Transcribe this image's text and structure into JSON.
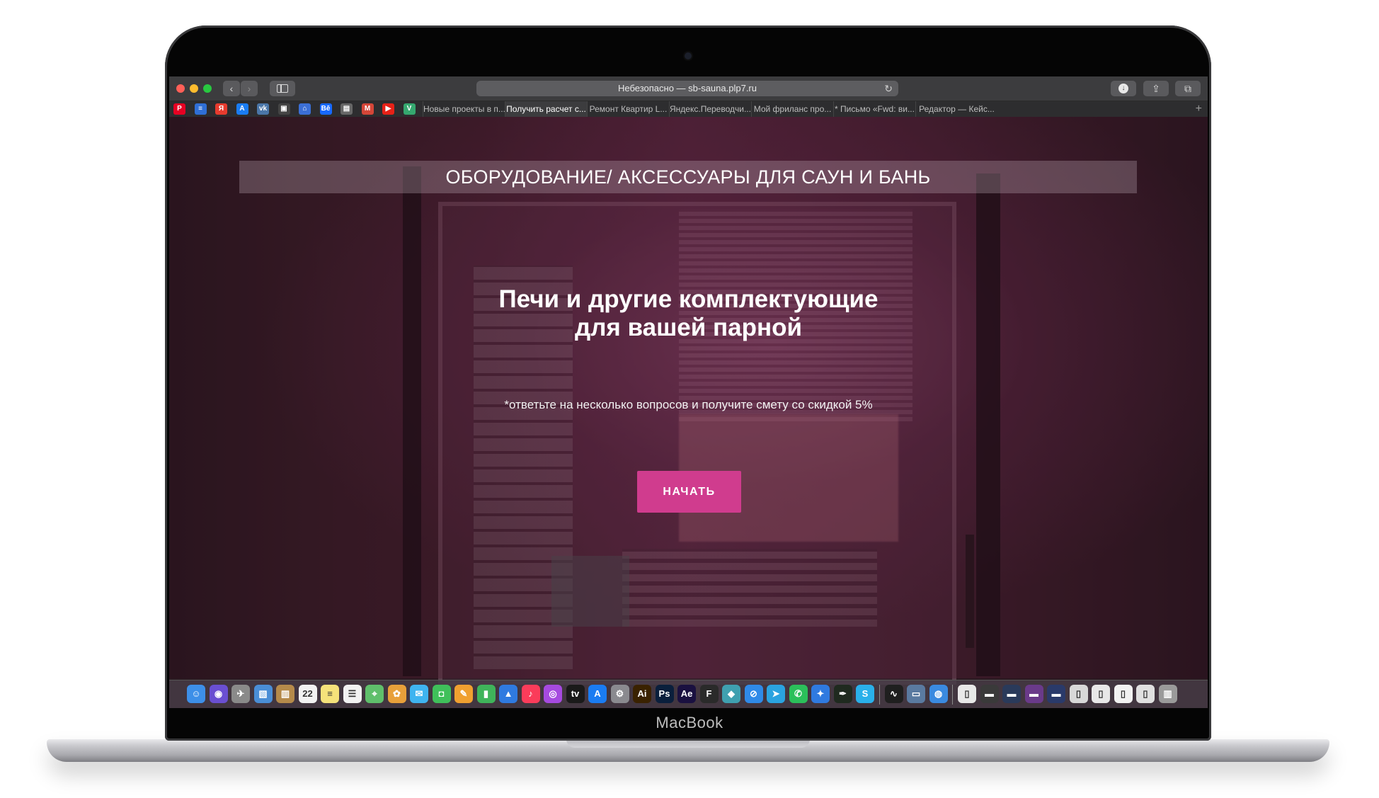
{
  "device": {
    "brand": "MacBook"
  },
  "browser": {
    "address": "Небезопасно — sb-sauna.plp7.ru",
    "reload_icon": "↻",
    "back_icon": "‹",
    "forward_icon": "›",
    "download_icon": "↓",
    "share_icon": "⇪",
    "tabs_icon": "⧉",
    "new_tab_icon": "+",
    "pinned": [
      {
        "name": "pinterest-icon",
        "glyph": "P",
        "color": "#e60023"
      },
      {
        "name": "list-icon",
        "glyph": "≡",
        "color": "#2f6fd6"
      },
      {
        "name": "yandex-icon",
        "glyph": "Я",
        "color": "#e63b2e"
      },
      {
        "name": "appstore-icon",
        "glyph": "A",
        "color": "#1a7cf2"
      },
      {
        "name": "vk-icon",
        "glyph": "vk",
        "color": "#4a76a8"
      },
      {
        "name": "chess-icon",
        "glyph": "▣",
        "color": "#444444"
      },
      {
        "name": "house-icon",
        "glyph": "⌂",
        "color": "#3b6fd6"
      },
      {
        "name": "behance-icon",
        "glyph": "Bē",
        "color": "#1769ff"
      },
      {
        "name": "print-icon",
        "glyph": "▤",
        "color": "#666666"
      },
      {
        "name": "gmail-icon",
        "glyph": "M",
        "color": "#d44638"
      },
      {
        "name": "youtube-icon",
        "glyph": "▶",
        "color": "#e62117"
      },
      {
        "name": "vue-icon",
        "glyph": "V",
        "color": "#35a86f"
      }
    ],
    "tabs": [
      {
        "label": "Новые проекты в п...",
        "active": false
      },
      {
        "label": "Получить расчет с...",
        "active": true
      },
      {
        "label": "Ремонт Квартир L...",
        "active": false
      },
      {
        "label": "Яндекс.Переводчи...",
        "active": false
      },
      {
        "label": "Мой фриланс про...",
        "active": false
      },
      {
        "label": "* Письмо «Fwd: ви...",
        "active": false
      },
      {
        "label": "Редактор — Кейс...",
        "active": false
      }
    ]
  },
  "page": {
    "banner": "ОБОРУДОВАНИЕ/ АКСЕССУАРЫ ДЛЯ САУН И БАНЬ",
    "headline_line1": "Печи и другие комплектующие",
    "headline_line2": "для вашей парной",
    "subtitle": "*ответьте на несколько вопросов и получите смету со скидкой 5%",
    "cta": "НАЧАТЬ",
    "cta_color": "#d03c8e"
  },
  "dock": {
    "apps": [
      {
        "name": "finder-icon",
        "glyph": "☺",
        "color": "#3d8fe8"
      },
      {
        "name": "siri-icon",
        "glyph": "◉",
        "color": "#6a4fd1"
      },
      {
        "name": "launchpad-icon",
        "glyph": "✈",
        "color": "#8a8a8a"
      },
      {
        "name": "preview-icon",
        "glyph": "▧",
        "color": "#4a8ed6"
      },
      {
        "name": "notes-book-icon",
        "glyph": "▥",
        "color": "#b58a4a"
      },
      {
        "name": "calendar-icon",
        "glyph": "22",
        "color": "#f2f2f2"
      },
      {
        "name": "notes-icon",
        "glyph": "≡",
        "color": "#f5e27a"
      },
      {
        "name": "reminders-icon",
        "glyph": "☰",
        "color": "#f2f2f2"
      },
      {
        "name": "maps-icon",
        "glyph": "⌖",
        "color": "#5fbf6b"
      },
      {
        "name": "photos-icon",
        "glyph": "✿",
        "color": "#e8a03a"
      },
      {
        "name": "messages-icon",
        "glyph": "✉",
        "color": "#3fb4f0"
      },
      {
        "name": "facetime-icon",
        "glyph": "◘",
        "color": "#3fc05a"
      },
      {
        "name": "pages-icon",
        "glyph": "✎",
        "color": "#f0a030"
      },
      {
        "name": "numbers-icon",
        "glyph": "▮",
        "color": "#3fb45a"
      },
      {
        "name": "keynote-icon",
        "glyph": "▲",
        "color": "#2f7ae0"
      },
      {
        "name": "music-icon",
        "glyph": "♪",
        "color": "#fa3c5a"
      },
      {
        "name": "podcasts-icon",
        "glyph": "◎",
        "color": "#a64ae0"
      },
      {
        "name": "tv-icon",
        "glyph": "tv",
        "color": "#1a1a1a"
      },
      {
        "name": "appstore-dock-icon",
        "glyph": "A",
        "color": "#1a7cf2"
      },
      {
        "name": "settings-icon",
        "glyph": "⚙",
        "color": "#8a8a8f"
      },
      {
        "name": "illustrator-icon",
        "glyph": "Ai",
        "color": "#3a2200"
      },
      {
        "name": "photoshop-icon",
        "glyph": "Ps",
        "color": "#0a1f3c"
      },
      {
        "name": "aftereffects-icon",
        "glyph": "Ae",
        "color": "#1a1040"
      },
      {
        "name": "figma-icon",
        "glyph": "F",
        "color": "#2a2a2a"
      },
      {
        "name": "sketch-icon",
        "glyph": "◆",
        "color": "#3fa0b0"
      },
      {
        "name": "safari-icon",
        "glyph": "⊘",
        "color": "#2f8ae8"
      },
      {
        "name": "telegram-icon",
        "glyph": "➤",
        "color": "#2aa3e0"
      },
      {
        "name": "whatsapp-icon",
        "glyph": "✆",
        "color": "#2bc05a"
      },
      {
        "name": "sourcetree-icon",
        "glyph": "✦",
        "color": "#2f7ae0"
      },
      {
        "name": "pen-icon",
        "glyph": "✒",
        "color": "#1f2a1f"
      },
      {
        "name": "skype-icon",
        "glyph": "S",
        "color": "#2ab0ea"
      },
      {
        "name": "activity-icon",
        "glyph": "∿",
        "color": "#1f1f1f"
      },
      {
        "name": "image-capture-icon",
        "glyph": "▭",
        "color": "#5a7aa0"
      },
      {
        "name": "network-icon",
        "glyph": "◍",
        "color": "#3a8ae0"
      },
      {
        "name": "document-icon",
        "glyph": "▯",
        "color": "#e8e8e8"
      },
      {
        "name": "folder-dark-icon",
        "glyph": "▬",
        "color": "#3a3a3a"
      },
      {
        "name": "folder-blue-icon",
        "glyph": "▬",
        "color": "#2a3a5a"
      },
      {
        "name": "folder-purple-icon",
        "glyph": "▬",
        "color": "#6a3a8a"
      },
      {
        "name": "folder-navy-icon",
        "glyph": "▬",
        "color": "#2a3a6a"
      },
      {
        "name": "files-icon",
        "glyph": "▯",
        "color": "#d8d8d8"
      },
      {
        "name": "files2-icon",
        "glyph": "▯",
        "color": "#e8e8e8"
      },
      {
        "name": "files3-icon",
        "glyph": "▯",
        "color": "#f2f2f2"
      },
      {
        "name": "files4-icon",
        "glyph": "▯",
        "color": "#e0e0e0"
      },
      {
        "name": "trash-icon",
        "glyph": "▥",
        "color": "#9a9a9a"
      }
    ]
  }
}
